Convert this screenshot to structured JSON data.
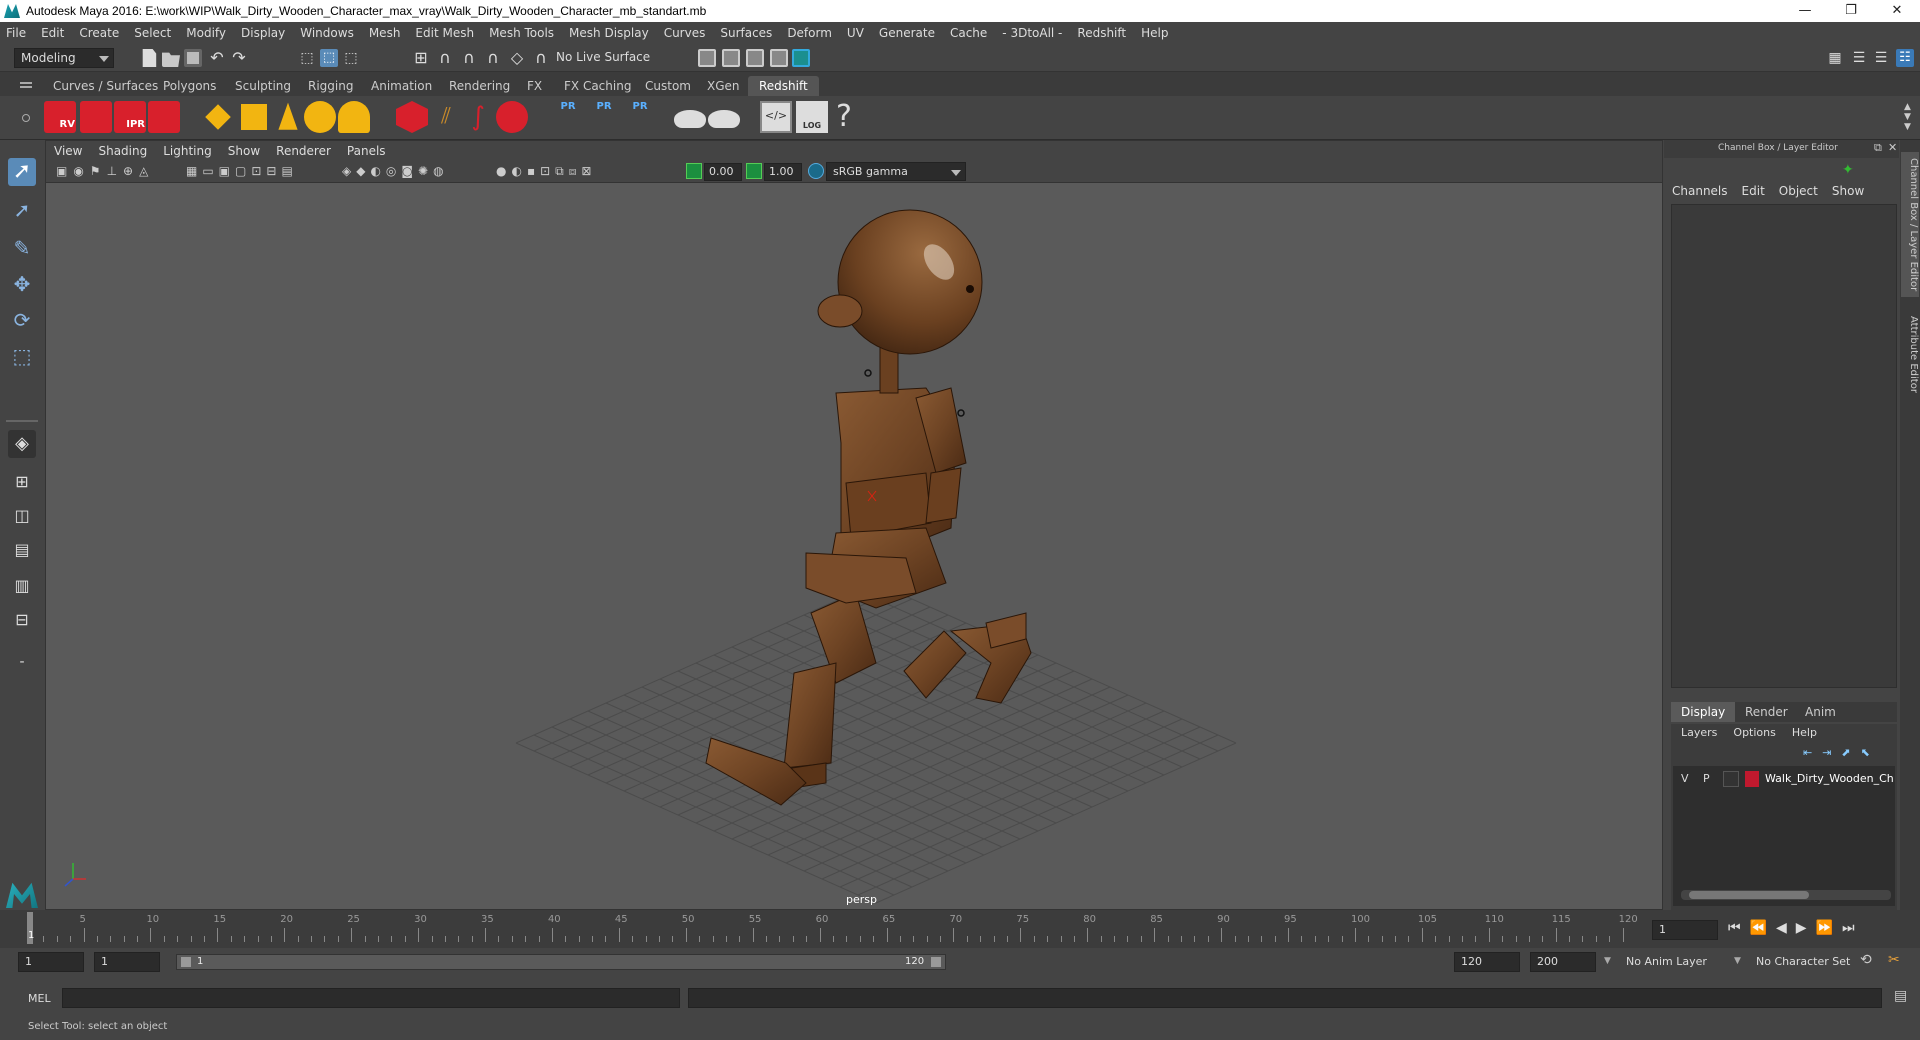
{
  "window": {
    "title": "Autodesk Maya 2016: E:\\work\\WIP\\Walk_Dirty_Wooden_Character_max_vray\\Walk_Dirty_Wooden_Character_mb_standart.mb",
    "minimize": "—",
    "restore": "❐",
    "close": "✕"
  },
  "menubar": {
    "items": [
      "File",
      "Edit",
      "Create",
      "Select",
      "Modify",
      "Display",
      "Windows",
      "Mesh",
      "Edit Mesh",
      "Mesh Tools",
      "Mesh Display",
      "Curves",
      "Surfaces",
      "Deform",
      "UV",
      "Generate",
      "Cache",
      "- 3DtoAll -",
      "Redshift",
      "Help"
    ]
  },
  "statusline": {
    "mode": "Modeling",
    "live_surface": "No Live Surface"
  },
  "shelf": {
    "tabs": [
      "Curves / Surfaces",
      "Polygons",
      "Sculpting",
      "Rigging",
      "Animation",
      "Rendering",
      "FX",
      "FX Caching",
      "Custom",
      "XGen",
      "Redshift"
    ],
    "active_tab": "Redshift",
    "icon_labels": {
      "rv": "RV",
      "ipr": "IPR",
      "pr1": "PR",
      "pr2": "PR",
      "pr3": "PR",
      "log": "LOG",
      "help": "?"
    }
  },
  "viewport": {
    "menu": [
      "View",
      "Shading",
      "Lighting",
      "Show",
      "Renderer",
      "Panels"
    ],
    "exposure": "0.00",
    "gamma": "1.00",
    "color_space": "sRGB gamma",
    "camera_label": "persp"
  },
  "channel_box": {
    "title": "Channel Box / Layer Editor",
    "menu": [
      "Channels",
      "Edit",
      "Object",
      "Show"
    ]
  },
  "layer_editor": {
    "tabs": [
      "Display",
      "Render",
      "Anim"
    ],
    "active_tab": "Display",
    "menu": [
      "Layers",
      "Options",
      "Help"
    ],
    "layer": {
      "visible": "V",
      "playback": "P",
      "name": "Walk_Dirty_Wooden_Ch",
      "color": "#c0192e"
    }
  },
  "side_tabs": [
    "Channel Box / Layer Editor",
    "Attribute Editor"
  ],
  "timeline": {
    "ticks": [
      "5",
      "10",
      "15",
      "20",
      "25",
      "30",
      "35",
      "40",
      "45",
      "50",
      "55",
      "60",
      "65",
      "70",
      "75",
      "80",
      "85",
      "90",
      "95",
      "100",
      "105",
      "110",
      "115",
      "120"
    ],
    "current_frame_marker": "1",
    "current_frame_field": "1"
  },
  "range": {
    "start_field": "1",
    "playback_start": "1",
    "slider_start": "1",
    "slider_end": "120",
    "playback_end": "120",
    "end_field": "200",
    "anim_layer": "No Anim Layer",
    "character_set": "No Character Set"
  },
  "cmdline": {
    "label": "MEL"
  },
  "helpline": {
    "text": "Select Tool: select an object"
  }
}
